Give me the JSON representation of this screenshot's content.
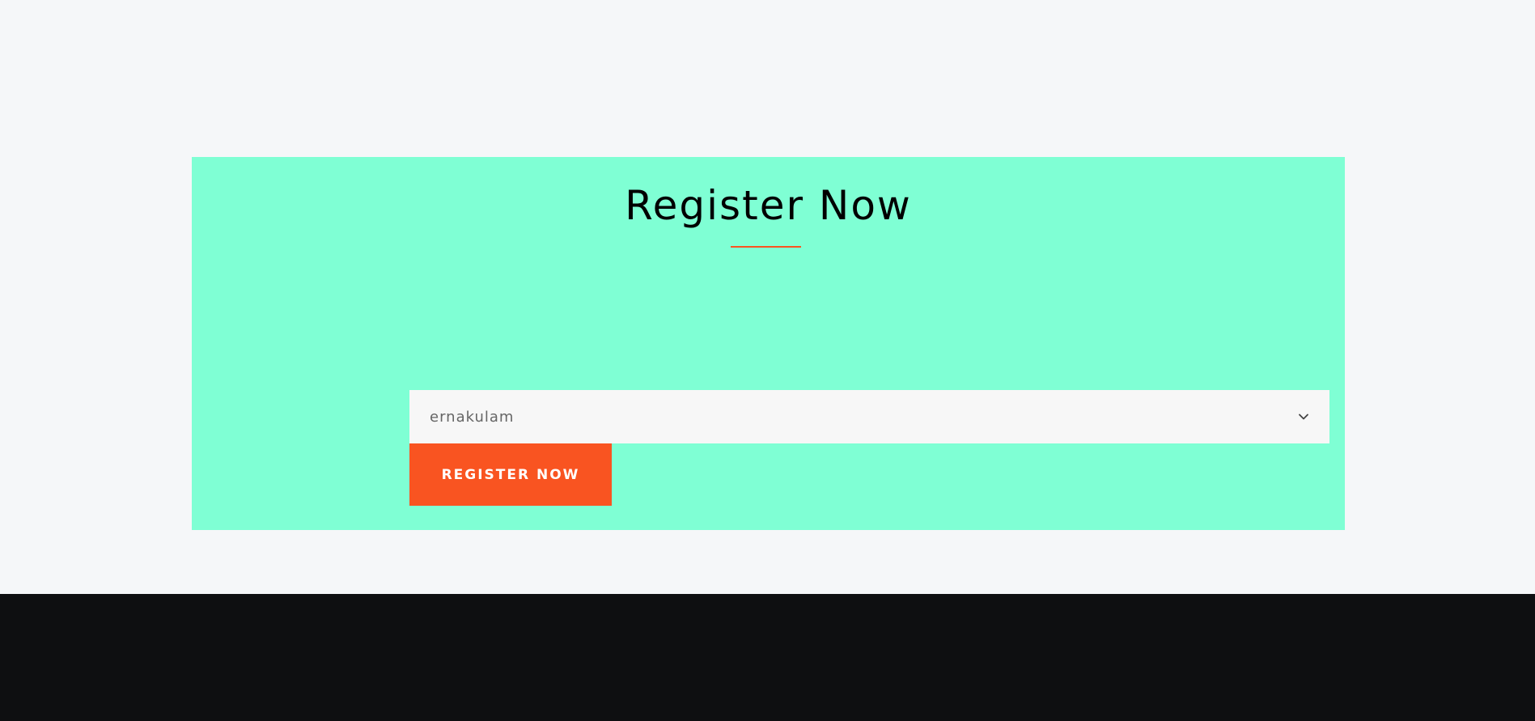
{
  "register": {
    "title": "Register Now",
    "city_select": {
      "selected_value": "ernakulam",
      "icon": "chevron-down-icon"
    },
    "button_label": "REGISTER NOW"
  },
  "colors": {
    "page_background": "#f5f7f9",
    "panel_background": "#7fffd4",
    "accent": "#f95421",
    "select_background": "#f7f7f7",
    "footer_background": "#0e0f11",
    "title_text": "#000000",
    "button_text": "#ffffff"
  }
}
